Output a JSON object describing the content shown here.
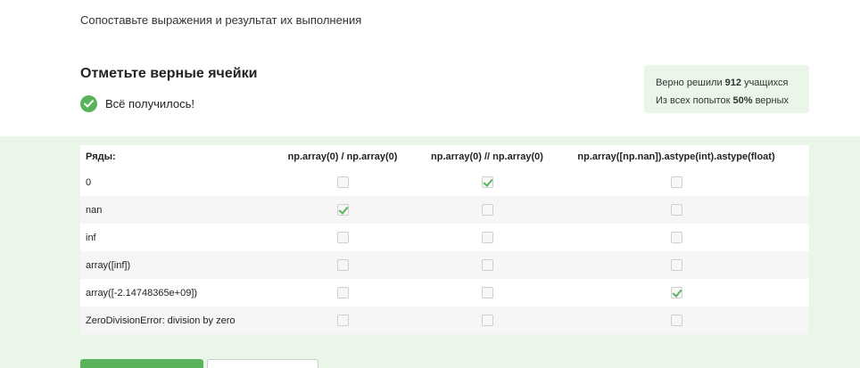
{
  "instruction": "Сопоставьте выражения и результат их выполнения",
  "question": {
    "title": "Отметьте верные ячейки",
    "status_text": "Всё получилось!"
  },
  "stats": {
    "solved_prefix": "Верно решили ",
    "solved_count": "912",
    "solved_suffix": " учащихся",
    "attempts_prefix": "Из всех попыток ",
    "attempts_percent": "50%",
    "attempts_suffix": " верных"
  },
  "table": {
    "rows_header": "Ряды:",
    "columns": [
      "np.array(0) / np.array(0)",
      "np.array(0) // np.array(0)",
      "np.array([np.nan]).astype(int).astype(float)"
    ],
    "rows": [
      {
        "label": "0",
        "checked": [
          false,
          true,
          false
        ]
      },
      {
        "label": "nan",
        "checked": [
          true,
          false,
          false
        ]
      },
      {
        "label": "inf",
        "checked": [
          false,
          false,
          false
        ]
      },
      {
        "label": "array([inf])",
        "checked": [
          false,
          false,
          false
        ]
      },
      {
        "label": "array([-2.14748365e+09])",
        "checked": [
          false,
          false,
          true
        ]
      },
      {
        "label": "ZeroDivisionError: division by zero",
        "checked": [
          false,
          false,
          false
        ]
      }
    ]
  },
  "colors": {
    "accent": "#59b35a",
    "panel_bg": "#e9f6e8"
  }
}
